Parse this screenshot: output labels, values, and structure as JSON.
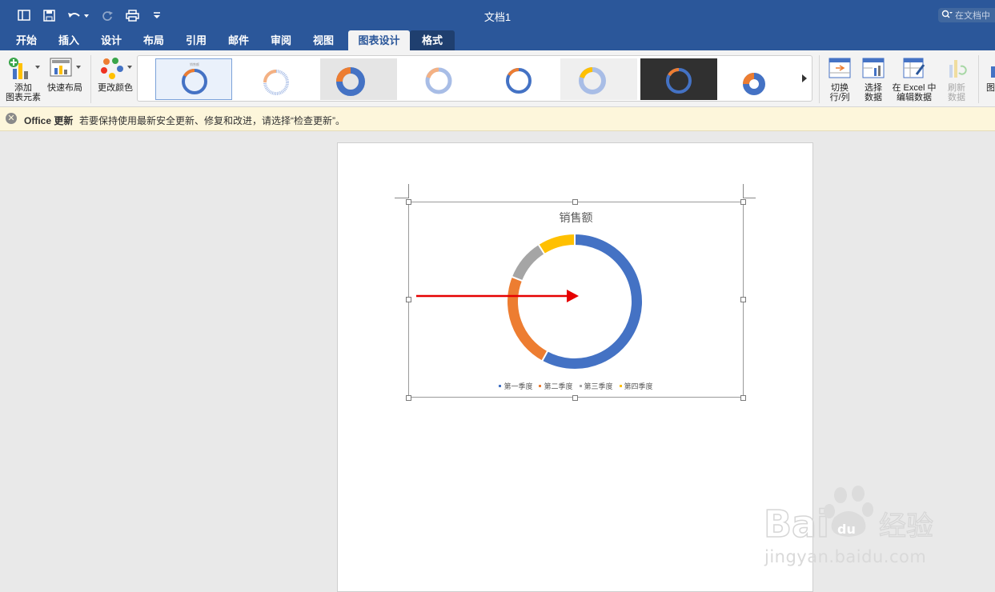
{
  "window": {
    "title": "文档1",
    "search_placeholder": "在文档中"
  },
  "tabs": [
    {
      "label": "开始"
    },
    {
      "label": "插入"
    },
    {
      "label": "设计"
    },
    {
      "label": "布局"
    },
    {
      "label": "引用"
    },
    {
      "label": "邮件"
    },
    {
      "label": "审阅"
    },
    {
      "label": "视图"
    },
    {
      "label": "图表设计",
      "active": true
    },
    {
      "label": "格式"
    }
  ],
  "ribbon": {
    "add_element": {
      "line1": "添加",
      "line2": "图表元素"
    },
    "quick_layout": {
      "label": "快速布局"
    },
    "change_colors": {
      "label": "更改颜色"
    },
    "switch_row_col": {
      "line1": "切换",
      "line2": "行/列"
    },
    "select_data": {
      "line1": "选择",
      "line2": "数据"
    },
    "edit_in_excel": {
      "line1": "在 Excel 中",
      "line2": "编辑数据"
    },
    "refresh_data": {
      "line1": "刷新",
      "line2": "数据",
      "disabled": true
    },
    "partial_right": {
      "label": "图"
    }
  },
  "message_bar": {
    "title": "Office 更新",
    "text": "若要保持使用最新安全更新、修复和改进，请选择“检查更新”。"
  },
  "chart_data": {
    "type": "doughnut",
    "title": "销售额",
    "categories": [
      "第一季度",
      "第二季度",
      "第三季度",
      "第四季度"
    ],
    "values": [
      58,
      23,
      10,
      9
    ],
    "colors": [
      "#4472c4",
      "#ed7d31",
      "#a5a5a5",
      "#ffc000"
    ]
  },
  "annotation": {
    "arrow_color": "#e60000"
  },
  "watermark": {
    "brand": "Bai du 经验",
    "url": "jingyan.baidu.com"
  }
}
